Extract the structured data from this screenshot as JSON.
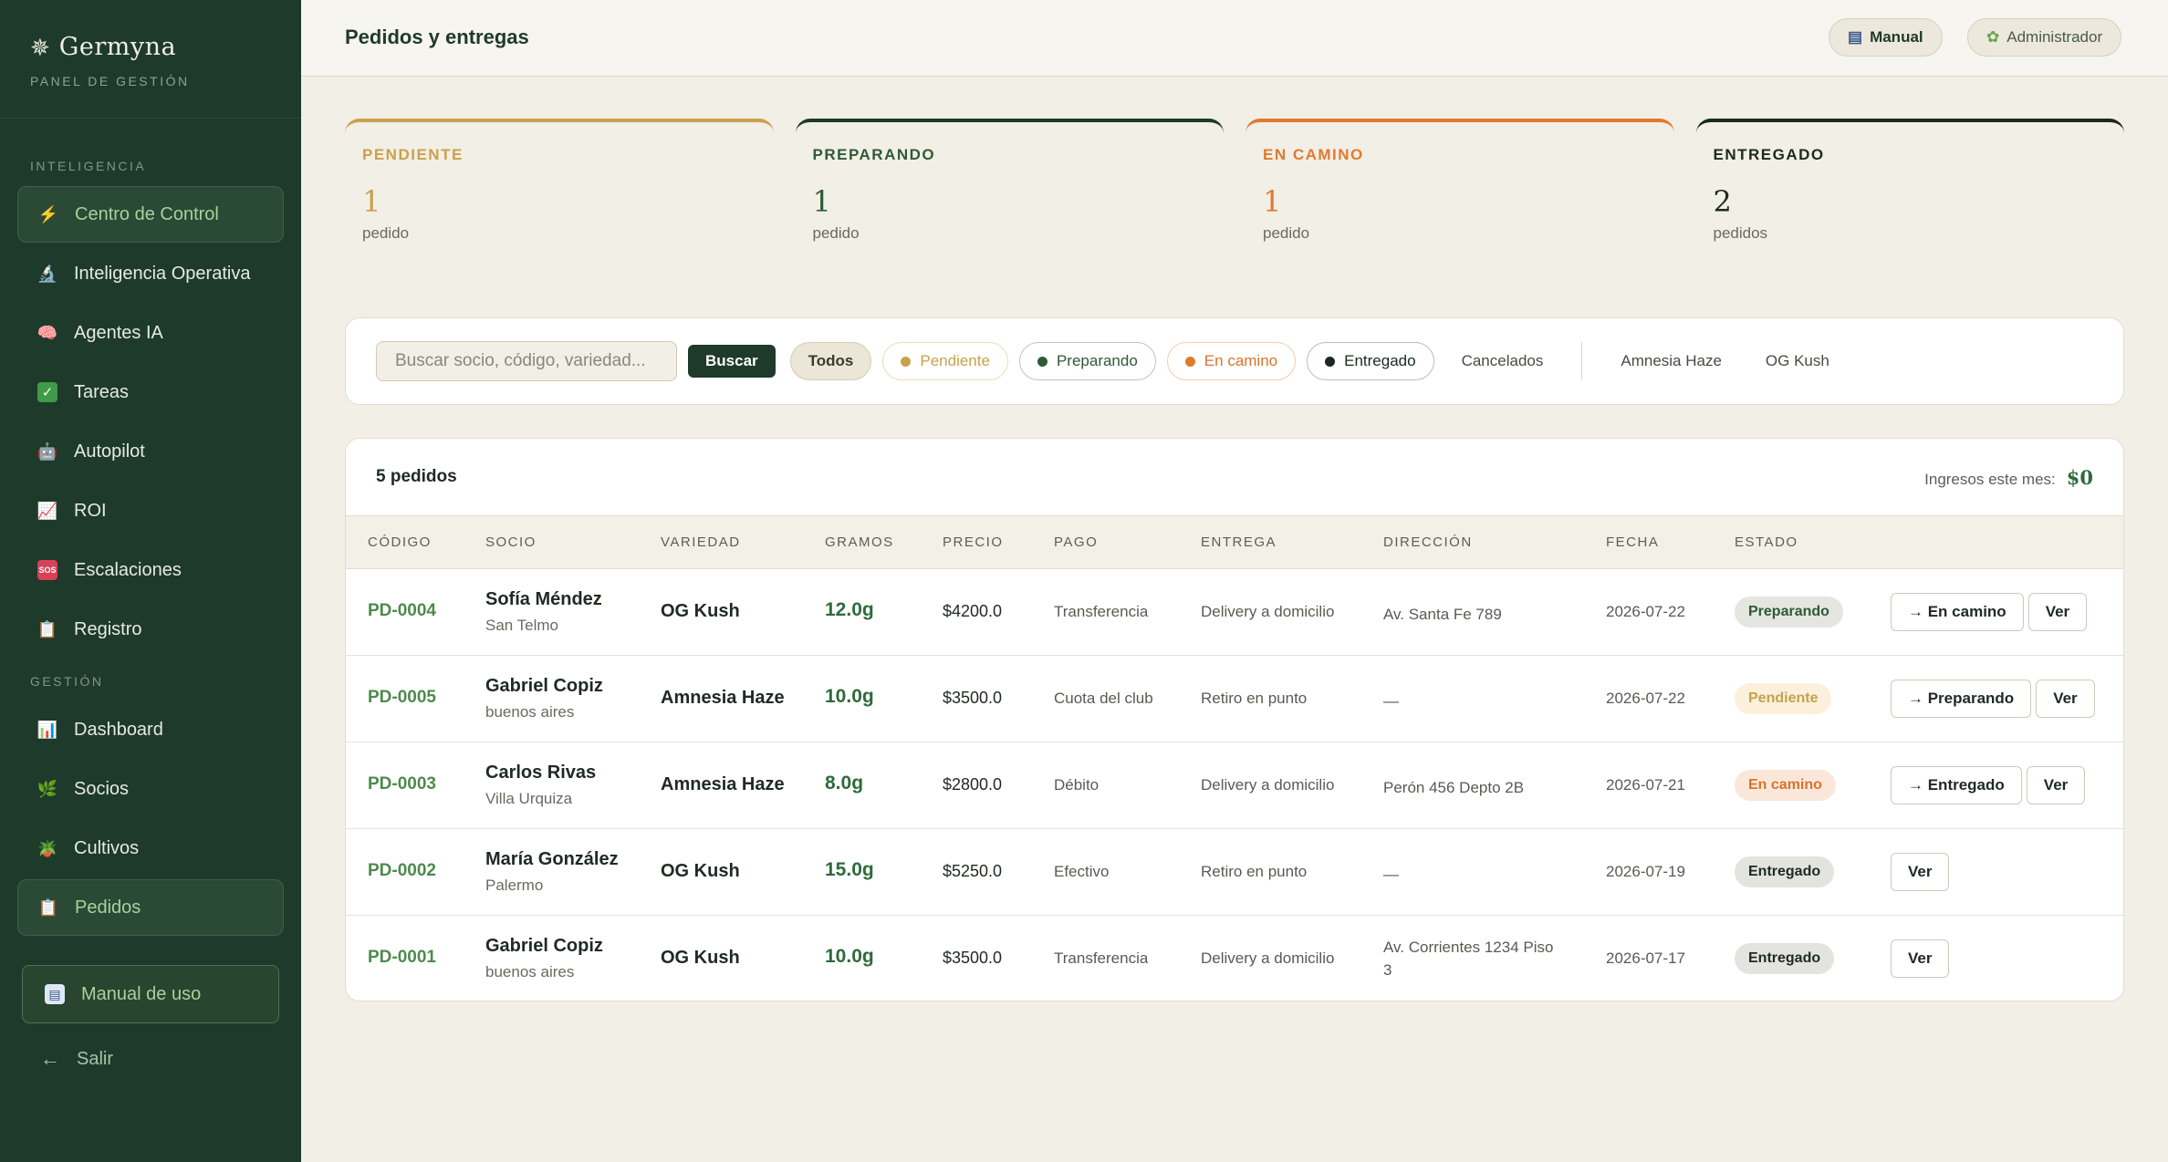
{
  "sidebar": {
    "brand": "Germyna",
    "subtitle": "PANEL DE GESTIÓN",
    "section1": "INTELIGENCIA",
    "section2": "GESTIÓN",
    "items1": [
      {
        "label": "Centro de Control",
        "icon": "⚡"
      },
      {
        "label": "Inteligencia Operativa",
        "icon": "🔬"
      },
      {
        "label": "Agentes IA",
        "icon": "🧠"
      },
      {
        "label": "Tareas",
        "icon": "✓"
      },
      {
        "label": "Autopilot",
        "icon": "🤖"
      },
      {
        "label": "ROI",
        "icon": "📈"
      },
      {
        "label": "Escalaciones",
        "icon": "SOS"
      },
      {
        "label": "Registro",
        "icon": "📋"
      }
    ],
    "items2": [
      {
        "label": "Dashboard",
        "icon": "📊"
      },
      {
        "label": "Socios",
        "icon": "🌿"
      },
      {
        "label": "Cultivos",
        "icon": "🪴"
      },
      {
        "label": "Pedidos",
        "icon": "📋"
      }
    ],
    "manual": "Manual de uso",
    "logout": "Salir",
    "logout_icon": "←"
  },
  "header": {
    "title": "Pedidos y entregas",
    "manual_btn": "Manual",
    "admin_btn": "Administrador"
  },
  "stats": [
    {
      "label": "PENDIENTE",
      "count": "1",
      "unit": "pedido",
      "color": "#c9a14a"
    },
    {
      "label": "PREPARANDO",
      "count": "1",
      "unit": "pedido",
      "color": "#1e3a2a"
    },
    {
      "label": "EN CAMINO",
      "count": "1",
      "unit": "pedido",
      "color": "#e07a2e"
    },
    {
      "label": "ENTREGADO",
      "count": "2",
      "unit": "pedidos",
      "color": "#1a2a20"
    }
  ],
  "filters": {
    "search_placeholder": "Buscar socio, código, variedad...",
    "search_button": "Buscar",
    "chips": [
      "Todos",
      "Pendiente",
      "Preparando",
      "En camino",
      "Entregado",
      "Cancelados"
    ],
    "varieties": [
      "Amnesia Haze",
      "OG Kush"
    ]
  },
  "orders": {
    "count_label": "5 pedidos",
    "income_label": "Ingresos este mes:",
    "income_value": "$0",
    "columns": [
      "CÓDIGO",
      "SOCIO",
      "VARIEDAD",
      "GRAMOS",
      "PRECIO",
      "PAGO",
      "ENTREGA",
      "DIRECCIÓN",
      "FECHA",
      "ESTADO"
    ],
    "rows": [
      {
        "code": "PD-0004",
        "name": "Sofía Méndez",
        "location": "San Telmo",
        "variety": "OG Kush",
        "grams": "12.0g",
        "price": "$4200.0",
        "payment": "Transferencia",
        "delivery": "Delivery a domicilio",
        "address": "Av. Santa Fe 789",
        "date": "2026-07-22",
        "status": "Preparando",
        "next": "→ En camino",
        "view": "Ver"
      },
      {
        "code": "PD-0005",
        "name": "Gabriel Copiz",
        "location": "buenos aires",
        "variety": "Amnesia Haze",
        "grams": "10.0g",
        "price": "$3500.0",
        "payment": "Cuota del club",
        "delivery": "Retiro en punto",
        "address": "—",
        "date": "2026-07-22",
        "status": "Pendiente",
        "next": "→ Preparando",
        "view": "Ver"
      },
      {
        "code": "PD-0003",
        "name": "Carlos Rivas",
        "location": "Villa Urquiza",
        "variety": "Amnesia Haze",
        "grams": "8.0g",
        "price": "$2800.0",
        "payment": "Débito",
        "delivery": "Delivery a domicilio",
        "address": "Perón 456 Depto 2B",
        "date": "2026-07-21",
        "status": "En camino",
        "next": "→ Entregado",
        "view": "Ver"
      },
      {
        "code": "PD-0002",
        "name": "María González",
        "location": "Palermo",
        "variety": "OG Kush",
        "grams": "15.0g",
        "price": "$5250.0",
        "payment": "Efectivo",
        "delivery": "Retiro en punto",
        "address": "—",
        "date": "2026-07-19",
        "status": "Entregado",
        "next": "",
        "view": "Ver"
      },
      {
        "code": "PD-0001",
        "name": "Gabriel Copiz",
        "location": "buenos aires",
        "variety": "OG Kush",
        "grams": "10.0g",
        "price": "$3500.0",
        "payment": "Transferencia",
        "delivery": "Delivery a domicilio",
        "address": "Av. Corrientes 1234 Piso 3",
        "date": "2026-07-17",
        "status": "Entregado",
        "next": "",
        "view": "Ver"
      }
    ]
  },
  "status_colors": {
    "Preparando": {
      "bg": "#e4e6df",
      "fg": "#2f5a36"
    },
    "Pendiente": {
      "bg": "#faf0dc",
      "fg": "#c9a14a"
    },
    "En camino": {
      "bg": "#fbe7da",
      "fg": "#d9742a"
    },
    "Entregado": {
      "bg": "#e3e4df",
      "fg": "#1f2a22"
    }
  }
}
